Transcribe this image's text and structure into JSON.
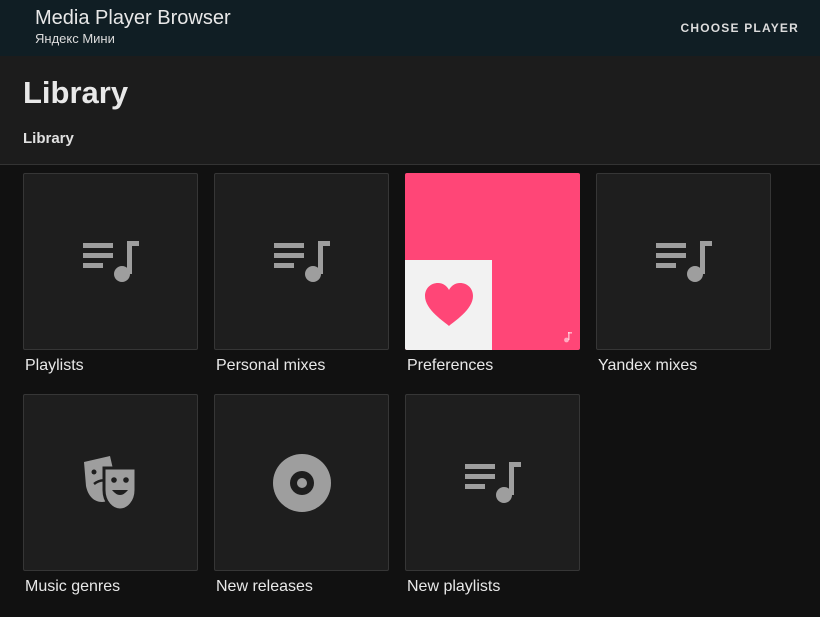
{
  "topbar": {
    "title": "Media Player Browser",
    "subtitle": "Яндекс Мини",
    "choose_player": "CHOOSE PLAYER",
    "background": "#101e24"
  },
  "header": {
    "title": "Library",
    "breadcrumb": "Library"
  },
  "tiles": [
    {
      "label": "Playlists",
      "icon": "playlist-music-icon"
    },
    {
      "label": "Personal mixes",
      "icon": "playlist-music-icon"
    },
    {
      "label": "Preferences",
      "icon": "heart-icon",
      "art_color": "#ff4677"
    },
    {
      "label": "Yandex mixes",
      "icon": "playlist-music-icon"
    },
    {
      "label": "Music genres",
      "icon": "drama-masks-icon"
    },
    {
      "label": "New releases",
      "icon": "vinyl-disc-icon"
    },
    {
      "label": "New playlists",
      "icon": "playlist-music-icon"
    }
  ],
  "colors": {
    "icon_gray": "#9e9e9e",
    "tile_bg": "#1e1e1e",
    "page_bg": "#111111"
  }
}
